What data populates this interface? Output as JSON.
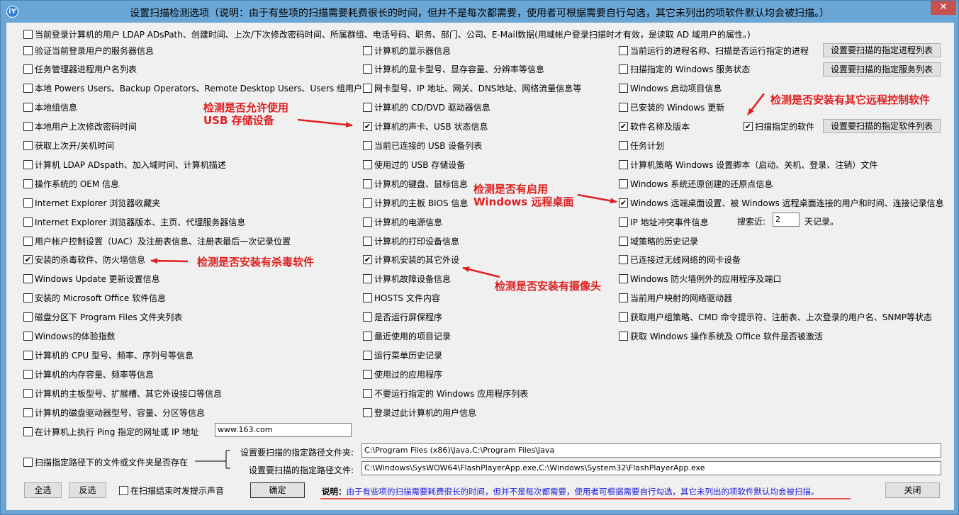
{
  "window": {
    "icon_text": "iY",
    "title": "设置扫描检测选项（说明：由于有些项的扫描需要耗费很长的时间，但并不是每次都需要，使用者可根据需要自行勾选，其它未列出的项软件默认均会被扫描。）",
    "close_glyph": "✕"
  },
  "top_option": "当前登录计算机的用户 LDAP ADsPath、创建时间、上次/下次修改密码时间、所属群组、电话号码、职务、部门、公司、E-Mail数据(用域帐户登录扫描时才有效，是读取 AD 域用户的属性。)",
  "col1": [
    {
      "label": "验证当前登录用户的服务器信息",
      "checked": false
    },
    {
      "label": "任务管理器进程用户名列表",
      "checked": false
    },
    {
      "label": "本地 Powers Users、Backup Operators、Remote Desktop Users、Users 组用户",
      "checked": false
    },
    {
      "label": "本地组信息",
      "checked": false
    },
    {
      "label": "本地用户上次修改密码时间",
      "checked": false
    },
    {
      "label": "获取上次开/关机时间",
      "checked": false
    },
    {
      "label": "计算机 LDAP ADspath、加入域时间、计算机描述",
      "checked": false
    },
    {
      "label": "操作系统的 OEM 信息",
      "checked": false
    },
    {
      "label": "Internet Explorer 浏览器收藏夹",
      "checked": false
    },
    {
      "label": "Internet Explorer 浏览器版本、主页、代理服务器信息",
      "checked": false
    },
    {
      "label": "用户帐户控制设置（UAC）及注册表信息、注册表最后一次记录位置",
      "checked": false
    },
    {
      "label": "安装的杀毒软件、防火墙信息",
      "checked": true
    },
    {
      "label": "Windows Update 更新设置信息",
      "checked": false
    },
    {
      "label": "安装的 Microsoft Office 软件信息",
      "checked": false
    },
    {
      "label": "磁盘分区下 Program Files 文件夹列表",
      "checked": false
    },
    {
      "label": "Windows的体验指数",
      "checked": false
    },
    {
      "label": "计算机的 CPU 型号、频率、序列号等信息",
      "checked": false
    },
    {
      "label": "计算机的内存容量、频率等信息",
      "checked": false
    },
    {
      "label": "计算机的主板型号、扩展槽、其它外设接口等信息",
      "checked": false
    },
    {
      "label": "计算机的磁盘驱动器型号、容量、分区等信息",
      "checked": false
    },
    {
      "label": "在计算机上执行 Ping 指定的网址或 IP 地址",
      "checked": false
    }
  ],
  "ping_value": "www.163.com",
  "col2": [
    {
      "label": "计算机的显示器信息",
      "checked": false
    },
    {
      "label": "计算机的显卡型号、显存容量、分辨率等信息",
      "checked": false
    },
    {
      "label": "网卡型号、IP 地址、网关、DNS地址、网络流量信息等",
      "checked": false
    },
    {
      "label": "计算机的 CD/DVD 驱动器信息",
      "checked": false
    },
    {
      "label": "计算机的声卡、USB 状态信息",
      "checked": true
    },
    {
      "label": "当前已连接的 USB 设备列表",
      "checked": false
    },
    {
      "label": "使用过的 USB 存储设备",
      "checked": false
    },
    {
      "label": "计算机的键盘、鼠标信息",
      "checked": false
    },
    {
      "label": "计算机的主板 BIOS 信息",
      "checked": false
    },
    {
      "label": "计算机的电源信息",
      "checked": false
    },
    {
      "label": "计算机的打印设备信息",
      "checked": false
    },
    {
      "label": "计算机安装的其它外设",
      "checked": true
    },
    {
      "label": "计算机故障设备信息",
      "checked": false
    },
    {
      "label": "HOSTS 文件内容",
      "checked": false
    },
    {
      "label": "是否运行屏保程序",
      "checked": false
    },
    {
      "label": "最近使用的项目记录",
      "checked": false
    },
    {
      "label": "运行菜单历史记录",
      "checked": false
    },
    {
      "label": "使用过的应用程序",
      "checked": false
    },
    {
      "label": "不要运行指定的 Windows 应用程序列表",
      "checked": false
    },
    {
      "label": "登录过此计算机的用户信息",
      "checked": false
    }
  ],
  "col3": [
    {
      "label": "当前运行的进程名称、扫描是否运行指定的进程",
      "checked": false
    },
    {
      "label": "扫描指定的 Windows 服务状态",
      "checked": false
    },
    {
      "label": "Windows 启动项目信息",
      "checked": false
    },
    {
      "label": "已安装的 Windows 更新",
      "checked": false
    },
    {
      "label": "软件名称及版本",
      "checked": true
    },
    {
      "label": "任务计划",
      "checked": false
    },
    {
      "label": "计算机策略 Windows 设置脚本（启动、关机、登录、注销）文件",
      "checked": false
    },
    {
      "label": "Windows 系统还原创建的还原点信息",
      "checked": false
    },
    {
      "label": "Windows 远端桌面设置、被 Windows 远程桌面连接的用户和时间、连接记录信息",
      "checked": true
    },
    {
      "label": "IP 地址冲突事件信息",
      "checked": false
    },
    {
      "label": "域策略的历史记录",
      "checked": false
    },
    {
      "label": "已连接过无线网络的网卡设备",
      "checked": false
    },
    {
      "label": "Windows 防火墙例外的应用程序及端口",
      "checked": false
    },
    {
      "label": "当前用户映射的网络驱动器",
      "checked": false
    },
    {
      "label": "获取用户组策略、CMD 命令提示符、注册表、上次登录的用户名、SNMP等状态",
      "checked": false
    },
    {
      "label": "获取 Windows 操作系统及 Office 软件是否被激活",
      "checked": false
    }
  ],
  "buttons": {
    "process_list": "设置要扫描的指定进程列表",
    "service_list": "设置要扫描的指定服务列表",
    "software_list": "设置要扫描的指定软件列表",
    "select_all": "全选",
    "invert": "反选",
    "ok": "确定",
    "close": "关闭"
  },
  "scan_software": {
    "label": "扫描指定的软件",
    "checked": true
  },
  "search_recent": {
    "prefix": "搜索近:",
    "value": "2",
    "suffix": "天记录。"
  },
  "path_scan": {
    "label": "扫描指定路径下的文件或文件夹是否存在",
    "checked": false,
    "folder_label": "设置要扫描的指定路径文件夹:",
    "folder_value": "C:\\Program Files (x86)\\Java,C:\\Program Files\\Java",
    "file_label": "设置要扫描的指定路径文件:",
    "file_value": "C:\\Windows\\SysWOW64\\FlashPlayerApp.exe,C:\\Windows\\System32\\FlashPlayerApp.exe"
  },
  "sound_option": {
    "label": "在扫描结束时发提示声音",
    "checked": false
  },
  "note": {
    "prefix": "说明：",
    "text": "由于有些项的扫描需要耗费很长的时间，但并不是每次都需要，使用者可根据需要自行勾选，其它未列出的项软件默认均会被扫描。"
  },
  "annotations": {
    "usb_line1": "检测是否允许使用",
    "usb_line2": "USB 存储设备",
    "remote_ctrl": "检测是否安装有其它远程控制软件",
    "rdp_line1": "检测是否有启用",
    "rdp_line2": "Windows 远程桌面",
    "antivirus": "检测是否安装有杀毒软件",
    "camera": "检测是否安装有摄像头"
  },
  "colors": {
    "annotation": "#e02020",
    "note_text": "#1a1adc",
    "title_bar": "#6ba7d6",
    "close_button": "#c75050"
  }
}
